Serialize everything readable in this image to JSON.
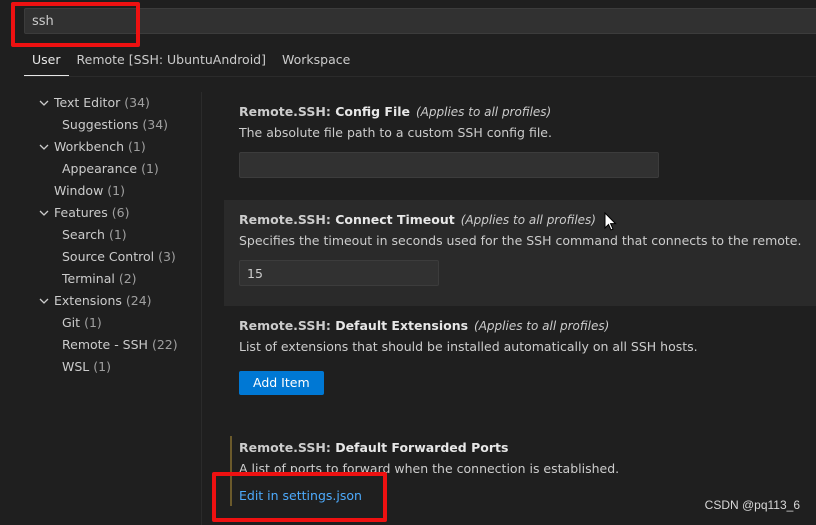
{
  "search": {
    "value": "ssh"
  },
  "tabs": [
    {
      "label": "User",
      "active": true
    },
    {
      "label": "Remote [SSH: UbuntuAndroid]",
      "active": false
    },
    {
      "label": "Workspace",
      "active": false
    }
  ],
  "toc": [
    {
      "label": "Text Editor",
      "count": "(34)",
      "level": 0,
      "expanded": true
    },
    {
      "label": "Suggestions",
      "count": "(34)",
      "level": 1
    },
    {
      "label": "Workbench",
      "count": "(1)",
      "level": 0,
      "expanded": true
    },
    {
      "label": "Appearance",
      "count": "(1)",
      "level": 1
    },
    {
      "label": "Window",
      "count": "(1)",
      "level": 0,
      "leaf": true
    },
    {
      "label": "Features",
      "count": "(6)",
      "level": 0,
      "expanded": true
    },
    {
      "label": "Search",
      "count": "(1)",
      "level": 1
    },
    {
      "label": "Source Control",
      "count": "(3)",
      "level": 1
    },
    {
      "label": "Terminal",
      "count": "(2)",
      "level": 1
    },
    {
      "label": "Extensions",
      "count": "(24)",
      "level": 0,
      "expanded": true
    },
    {
      "label": "Git",
      "count": "(1)",
      "level": 1
    },
    {
      "label": "Remote - SSH",
      "count": "(22)",
      "level": 1
    },
    {
      "label": "WSL",
      "count": "(1)",
      "level": 1
    }
  ],
  "settings": {
    "config_file": {
      "category": "Remote.SSH: ",
      "name": "Config File",
      "scope": "(Applies to all profiles)",
      "description": "The absolute file path to a custom SSH config file.",
      "value": ""
    },
    "connect_timeout": {
      "category": "Remote.SSH: ",
      "name": "Connect Timeout",
      "scope": "(Applies to all profiles)",
      "description": "Specifies the timeout in seconds used for the SSH command that connects to the remote.",
      "value": "15"
    },
    "default_extensions": {
      "category": "Remote.SSH: ",
      "name": "Default Extensions",
      "scope": "(Applies to all profiles)",
      "description": "List of extensions that should be installed automatically on all SSH hosts.",
      "button_label": "Add Item"
    },
    "default_forwarded_ports": {
      "category": "Remote.SSH: ",
      "name": "Default Forwarded Ports",
      "description": "A list of ports to forward when the connection is established.",
      "link_label": "Edit in settings.json"
    }
  },
  "watermark": "CSDN @pq113_6",
  "colors": {
    "background": "#1f1f1f",
    "accent_button": "#0078d4",
    "link": "#4daafc",
    "annotation_box": "#ee1111"
  }
}
